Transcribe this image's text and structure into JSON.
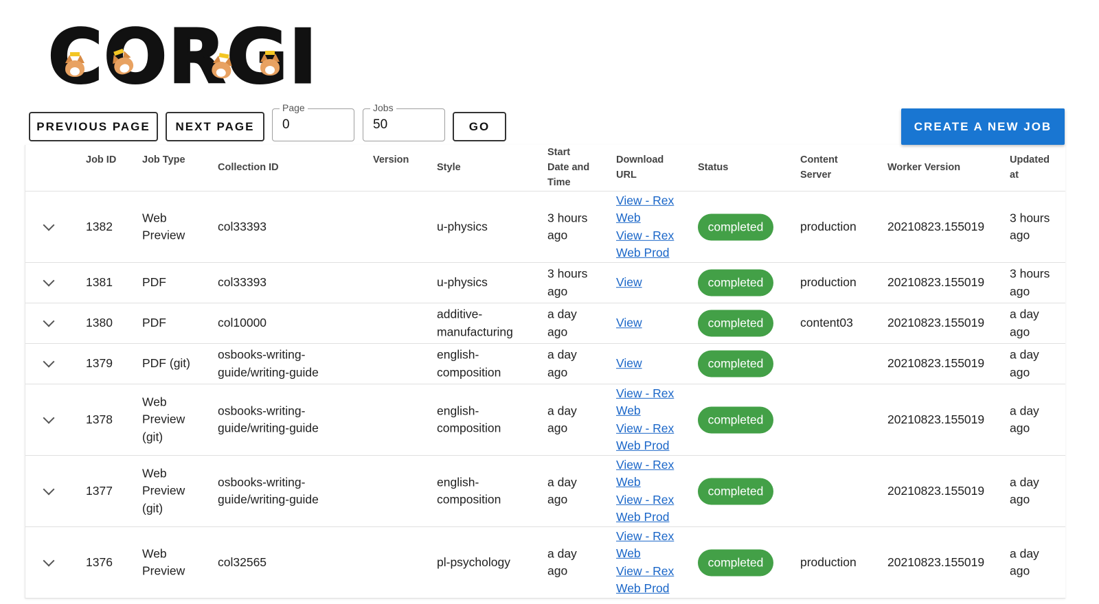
{
  "logo": {
    "text": "CORGI"
  },
  "toolbar": {
    "prev_label": "PREVIOUS PAGE",
    "next_label": "NEXT PAGE",
    "page_label": "Page",
    "page_value": "0",
    "jobs_label": "Jobs",
    "jobs_value": "50",
    "go_label": "GO",
    "create_label": "CREATE A NEW JOB"
  },
  "colors": {
    "primary": "#1976d2",
    "status_completed": "#43a047",
    "link": "#1a66c8"
  },
  "table": {
    "headers": {
      "job_id": "Job ID",
      "job_type": "Job Type",
      "collection_id": "Collection ID",
      "version": "Version",
      "style": "Style",
      "start": [
        "Start",
        "Date and",
        "Time"
      ],
      "download": [
        "Download",
        "URL"
      ],
      "status": "Status",
      "content_server": [
        "Content",
        "Server"
      ],
      "worker_version": "Worker Version",
      "updated": [
        "Updated",
        "at"
      ]
    },
    "rows": [
      {
        "id": "1382",
        "type": [
          "Web",
          "Preview"
        ],
        "collection": [
          "col33393"
        ],
        "version": "",
        "style": [
          "u-physics"
        ],
        "start": [
          "3 hours",
          "ago"
        ],
        "links": [
          "View - Rex",
          "Web",
          "View - Rex",
          "Web Prod"
        ],
        "status": "completed",
        "server": "production",
        "worker": "20210823.155019",
        "updated": [
          "3 hours",
          "ago"
        ]
      },
      {
        "id": "1381",
        "type": [
          "PDF"
        ],
        "collection": [
          "col33393"
        ],
        "version": "",
        "style": [
          "u-physics"
        ],
        "start": [
          "3 hours",
          "ago"
        ],
        "links": [
          "View"
        ],
        "status": "completed",
        "server": "production",
        "worker": "20210823.155019",
        "updated": [
          "3 hours",
          "ago"
        ]
      },
      {
        "id": "1380",
        "type": [
          "PDF"
        ],
        "collection": [
          "col10000"
        ],
        "version": "",
        "style": [
          "additive-",
          "manufacturing"
        ],
        "start": [
          "a day",
          "ago"
        ],
        "links": [
          "View"
        ],
        "status": "completed",
        "server": "content03",
        "worker": "20210823.155019",
        "updated": [
          "a day",
          "ago"
        ]
      },
      {
        "id": "1379",
        "type": [
          "PDF (git)"
        ],
        "collection": [
          "osbooks-writing-",
          "guide/writing-guide"
        ],
        "version": "",
        "style": [
          "english-",
          "composition"
        ],
        "start": [
          "a day",
          "ago"
        ],
        "links": [
          "View"
        ],
        "status": "completed",
        "server": "",
        "worker": "20210823.155019",
        "updated": [
          "a day",
          "ago"
        ]
      },
      {
        "id": "1378",
        "type": [
          "Web",
          "Preview",
          "(git)"
        ],
        "collection": [
          "osbooks-writing-",
          "guide/writing-guide"
        ],
        "version": "",
        "style": [
          "english-",
          "composition"
        ],
        "start": [
          "a day",
          "ago"
        ],
        "links": [
          "View - Rex",
          "Web",
          "View - Rex",
          "Web Prod"
        ],
        "status": "completed",
        "server": "",
        "worker": "20210823.155019",
        "updated": [
          "a day",
          "ago"
        ]
      },
      {
        "id": "1377",
        "type": [
          "Web",
          "Preview",
          "(git)"
        ],
        "collection": [
          "osbooks-writing-",
          "guide/writing-guide"
        ],
        "version": "",
        "style": [
          "english-",
          "composition"
        ],
        "start": [
          "a day",
          "ago"
        ],
        "links": [
          "View - Rex",
          "Web",
          "View - Rex",
          "Web Prod"
        ],
        "status": "completed",
        "server": "",
        "worker": "20210823.155019",
        "updated": [
          "a day",
          "ago"
        ]
      },
      {
        "id": "1376",
        "type": [
          "Web",
          "Preview"
        ],
        "collection": [
          "col32565"
        ],
        "version": "",
        "style": [
          "pl-psychology"
        ],
        "start": [
          "a day",
          "ago"
        ],
        "links": [
          "View - Rex",
          "Web",
          "View - Rex",
          "Web Prod"
        ],
        "status": "completed",
        "server": "production",
        "worker": "20210823.155019",
        "updated": [
          "a day",
          "ago"
        ]
      }
    ]
  }
}
